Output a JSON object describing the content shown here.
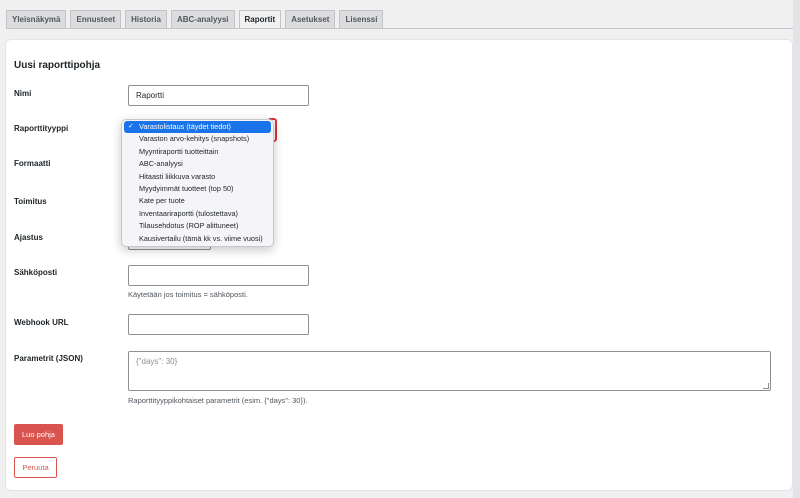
{
  "tabs": [
    "Yleisnäkymä",
    "Ennusteet",
    "Historia",
    "ABC-analyysi",
    "Raportit",
    "Asetukset",
    "Lisenssi"
  ],
  "active_tab": "Raportit",
  "form": {
    "title": "Uusi raporttipohja",
    "name_label": "Nimi",
    "name_value": "Raportti",
    "type_label": "Raporttityyppi",
    "format_label": "Formaatti",
    "delivery_label": "Toimitus",
    "schedule_label": "Ajastus",
    "email_label": "Sähköposti",
    "email_help": "Käytetään jos toimitus = sähköposti.",
    "webhook_label": "Webhook URL",
    "params_label": "Parametrit (JSON)",
    "params_placeholder": "{\"days\": 30}",
    "params_help": "Raporttityyppikohtaiset parametrit (esim. {\"days\": 30}).",
    "create_button": "Luo pohja",
    "cancel_button": "Peruuta"
  },
  "report_type_dropdown": {
    "selected": "Varastolistaus (täydet tiedot)",
    "check_glyph": "✓",
    "options": [
      "Varastolistaus (täydet tiedot)",
      "Varaston arvo-kehitys (snapshots)",
      "Myyntiraportti tuotteittain",
      "ABC-analyysi",
      "Hitaasti liikkuva varasto",
      "Myydyimmät tuotteet (top 50)",
      "Kate per tuote",
      "Inventaariraportti (tulostettava)",
      "Tilausehdotus (ROP alittuneet)",
      "Kausivertailu (tämä kk vs. viime vuosi)"
    ]
  },
  "colors": {
    "accent_red": "#d9534f",
    "dropdown_highlight": "#1a73e8",
    "focus_red": "#d63638"
  }
}
